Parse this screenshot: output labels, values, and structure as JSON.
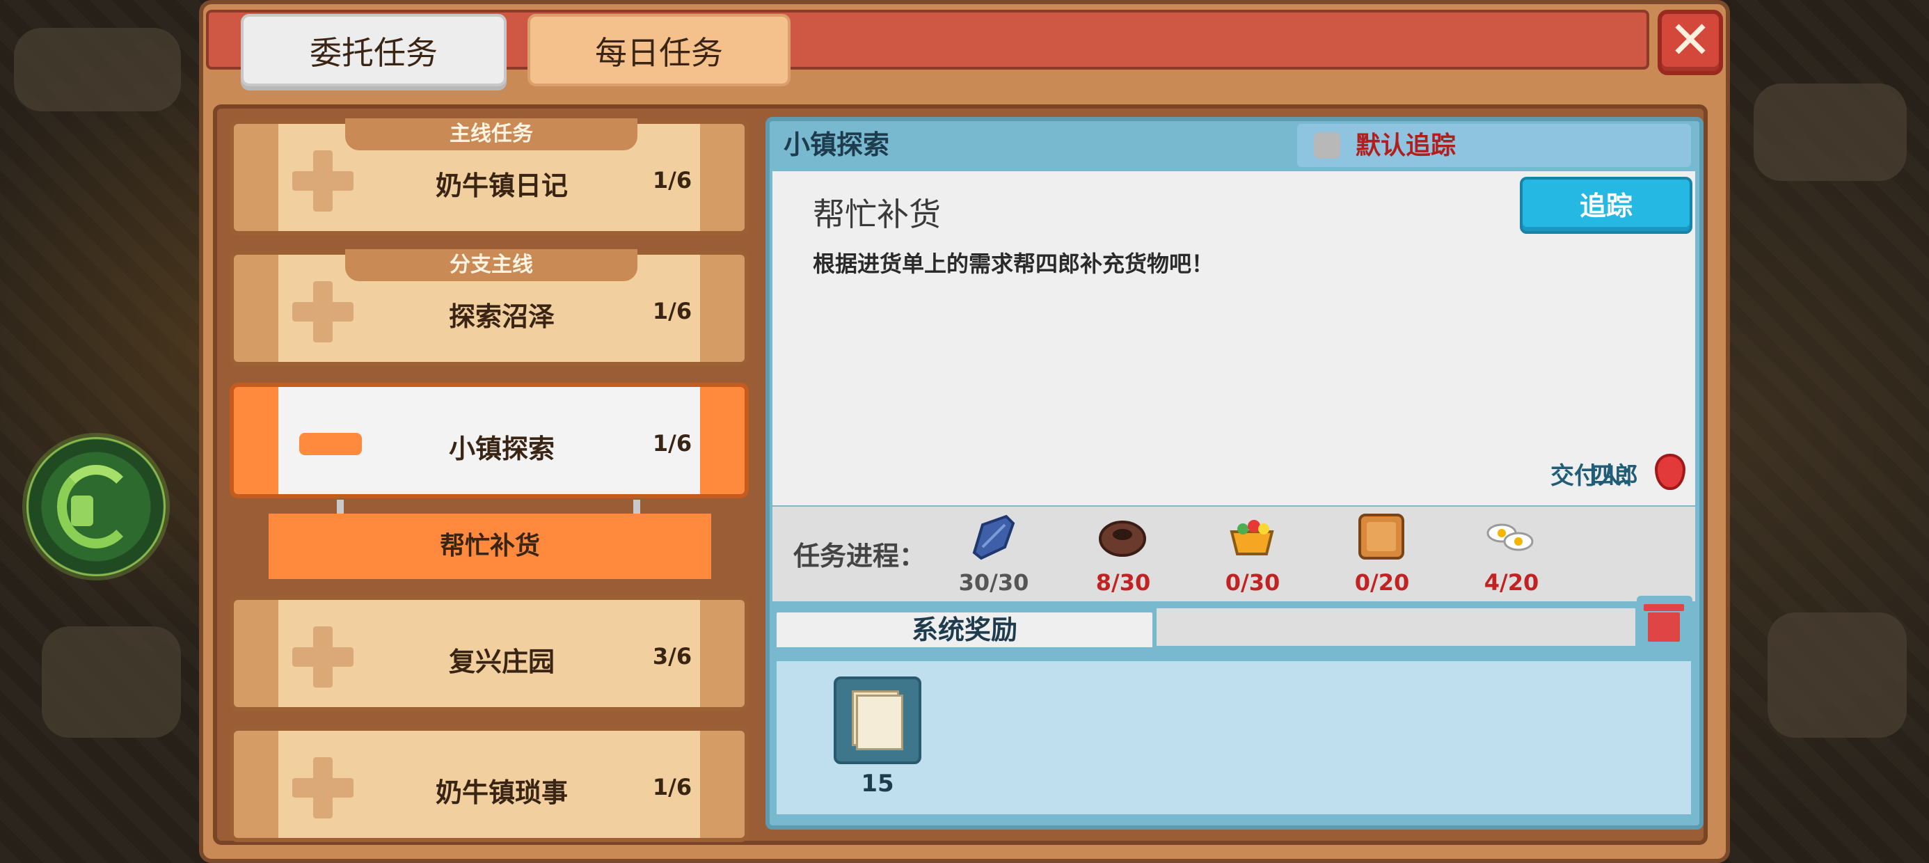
{
  "tabs": {
    "commission": "委托任务",
    "daily": "每日任务"
  },
  "quest_list": [
    {
      "category": "主线任务",
      "name": "奶牛镇日记",
      "progress": "1/6",
      "state": "collapsed"
    },
    {
      "category": "分支主线",
      "name": "探索沼泽",
      "progress": "1/6",
      "state": "collapsed"
    },
    {
      "category": "",
      "name": "小镇探索",
      "progress": "1/6",
      "state": "expanded",
      "sub": "帮忙补货"
    },
    {
      "category": "",
      "name": "复兴庄园",
      "progress": "3/6",
      "state": "collapsed"
    },
    {
      "category": "",
      "name": "奶牛镇琐事",
      "progress": "1/6",
      "state": "collapsed"
    }
  ],
  "detail": {
    "header": "小镇探索",
    "default_track": "默认追踪",
    "title": "帮忙补货",
    "description": "根据进货单上的需求帮四郎补充货物吧！",
    "track_button": "追踪",
    "deliver_label": "交付人：",
    "deliver_name": "四郎",
    "progress_label": "任务进程：",
    "items": [
      {
        "icon": "blue-fish-icon",
        "count": "30/30",
        "color": "#555555"
      },
      {
        "icon": "clay-pot-icon",
        "count": "8/30",
        "color": "#c22222"
      },
      {
        "icon": "salad-bowl-icon",
        "count": "0/30",
        "color": "#c22222"
      },
      {
        "icon": "bread-icon",
        "count": "0/20",
        "color": "#c22222"
      },
      {
        "icon": "fried-egg-icon",
        "count": "4/20",
        "color": "#c22222"
      }
    ],
    "reward_tab": "系统奖励",
    "reward_count": "15"
  }
}
